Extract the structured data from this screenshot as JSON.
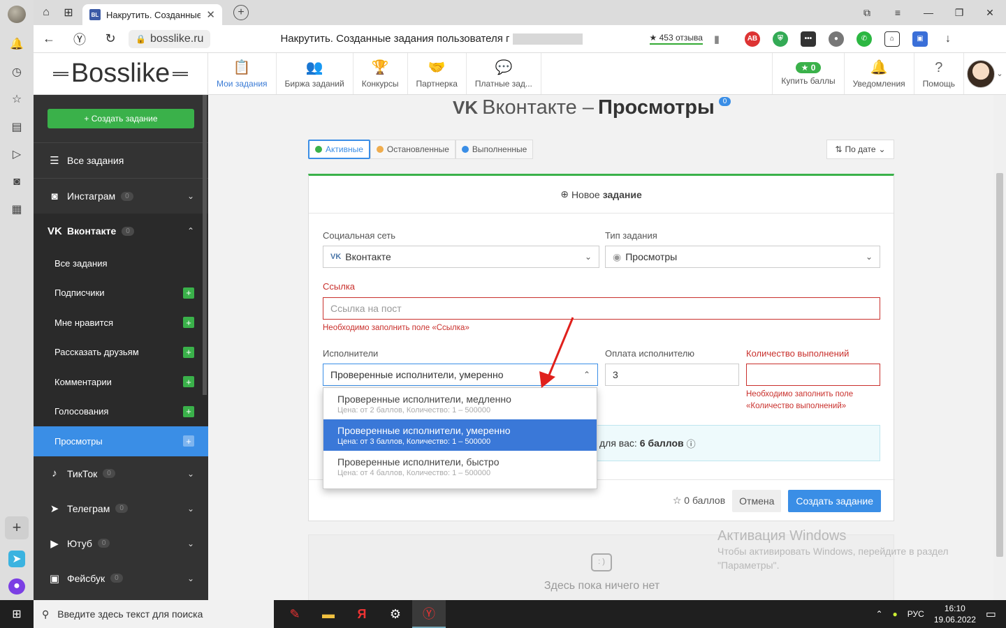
{
  "browser": {
    "tab_title": "Накрутить. Созданные",
    "tab_favicon": "BL",
    "url": "bosslike.ru",
    "page_title": "Накрутить. Созданные задания пользователя г",
    "reviews": "453 отзыва"
  },
  "header": {
    "logo": "Bosslike",
    "nav": [
      {
        "label": "Мои задания",
        "icon": "clipboard-icon"
      },
      {
        "label": "Биржа заданий",
        "icon": "users-icon"
      },
      {
        "label": "Конкурсы",
        "icon": "trophy-icon"
      },
      {
        "label": "Партнерка",
        "icon": "handshake-icon"
      },
      {
        "label": "Платные зад...",
        "icon": "paid-chat-icon"
      }
    ],
    "buy_points_badge": "0",
    "buy_points": "Купить баллы",
    "notifications": "Уведомления",
    "help": "Помощь"
  },
  "sidebar": {
    "create_button": "+ Создать задание",
    "items": [
      {
        "label": "Все задания"
      },
      {
        "label": "Инстаграм",
        "count": "0"
      },
      {
        "label": "Вконтакте",
        "count": "0"
      }
    ],
    "vk_sub": [
      "Все задания",
      "Подписчики",
      "Мне нравится",
      "Рассказать друзьям",
      "Комментарии",
      "Голосования",
      "Просмотры"
    ],
    "more": [
      {
        "label": "ТикТок",
        "count": "0"
      },
      {
        "label": "Телеграм",
        "count": "0"
      },
      {
        "label": "Ютуб",
        "count": "0"
      },
      {
        "label": "Фейсбук",
        "count": "0"
      }
    ]
  },
  "main": {
    "title_prefix": "Вконтакте –",
    "title_bold": "Просмотры",
    "title_badge": "0",
    "filters": [
      "Активные",
      "Остановленные",
      "Выполненные"
    ],
    "sort": "По дате",
    "new_task_prefix": "Новое",
    "new_task_bold": "задание",
    "social_label": "Социальная сеть",
    "social_value": "Вконтакте",
    "type_label": "Тип задания",
    "type_value": "Просмотры",
    "link_label": "Ссылка",
    "link_placeholder": "Ссылка на пост",
    "link_error": "Необходимо заполнить поле «Ссылка»",
    "performers_label": "Исполнители",
    "performers_value": "Проверенные исполнители, умеренно",
    "pay_label": "Оплата исполнителю",
    "pay_value": "3",
    "count_label": "Количество выполнений",
    "count_error": "Необходимо заполнить поле «Количество выполнений»",
    "info_text": "для вас:",
    "info_bold": "6 баллов",
    "points": "0 баллов",
    "cancel": "Отмена",
    "create": "Создать задание",
    "dropdown": [
      {
        "title": "Проверенные исполнители, медленно",
        "sub": "Цена: от 2 баллов, Количество: 1 – 500000"
      },
      {
        "title": "Проверенные исполнители, умеренно",
        "sub": "Цена: от 3 баллов, Количество: 1 – 500000"
      },
      {
        "title": "Проверенные исполнители, быстро",
        "sub": "Цена: от 4 баллов, Количество: 1 – 500000"
      }
    ],
    "empty": "Здесь пока ничего нет"
  },
  "activation": {
    "title": "Активация Windows",
    "text": "Чтобы активировать Windows, перейдите в раздел \"Параметры\"."
  },
  "taskbar": {
    "search": "Введите здесь текст для поиска",
    "lang": "РУС",
    "time": "16:10",
    "date": "19.06.2022"
  },
  "colors": {
    "accent": "#3a8ee6",
    "green": "#3ab14a",
    "error": "#c9302c",
    "sidebar": "#333333"
  }
}
